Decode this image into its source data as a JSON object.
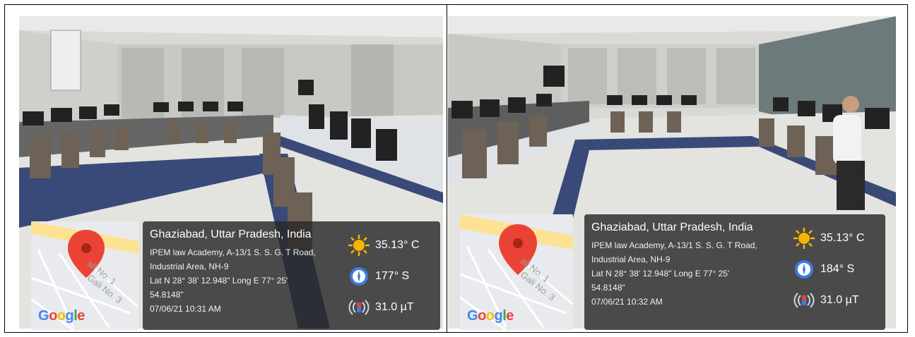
{
  "photos": [
    {
      "map": {
        "brand": [
          "G",
          "o",
          "o",
          "g",
          "l",
          "e"
        ],
        "streets": [
          "ali No. 1",
          "Gali No. 3"
        ]
      },
      "location": {
        "city": "Ghaziabad, Uttar Pradesh, India",
        "address_line1": "IPEM law Academy, A-13/1 S. S. G. T Road,",
        "address_line2": "Industrial Area, NH-9",
        "coords_line1": "Lat N 28° 38' 12.948\" Long E 77° 25'",
        "coords_line2": "54.8148\"",
        "datetime": "07/06/21 10:31 AM"
      },
      "metrics": {
        "temperature": "35.13° C",
        "heading": "177° S",
        "magnetic": "31.0 µT"
      }
    },
    {
      "map": {
        "brand": [
          "G",
          "o",
          "o",
          "g",
          "l",
          "e"
        ],
        "streets": [
          "ali No. 1",
          "Gali No. 3"
        ]
      },
      "location": {
        "city": "Ghaziabad, Uttar Pradesh, India",
        "address_line1": "IPEM law Academy, A-13/1 S. S. G. T Road,",
        "address_line2": "Industrial Area, NH-9",
        "coords_line1": "Lat N 28° 38' 12.948\" Long E 77° 25'",
        "coords_line2": "54.8148\"",
        "datetime": "07/06/21 10:32 AM"
      },
      "metrics": {
        "temperature": "35.13° C",
        "heading": "184° S",
        "magnetic": "31.0 µT"
      }
    }
  ],
  "colors": {
    "overlay": "#282828",
    "pin": "#ea4335",
    "sun": "#f7b500",
    "compass": "#3d7be0",
    "magnet": "#e04545"
  }
}
